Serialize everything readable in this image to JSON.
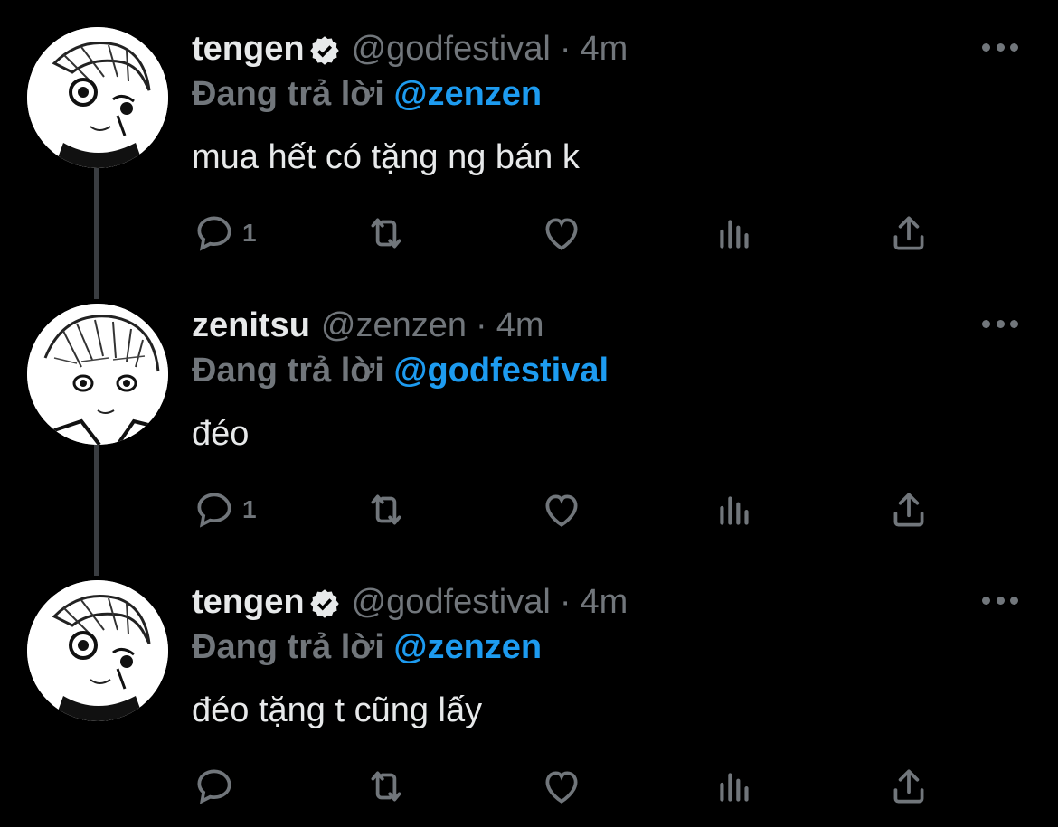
{
  "colors": {
    "background": "#000000",
    "text": "#e7e9ea",
    "muted": "#71767b",
    "accent": "#1d9bf0",
    "thread_line": "#3a3d41"
  },
  "icons": {
    "reply": "comment-bubble-icon",
    "retweet": "retweet-arrows-icon",
    "like": "heart-icon",
    "views": "bar-chart-icon",
    "share": "share-upload-icon",
    "more": "ellipsis-icon",
    "verified": "verified-badge-icon"
  },
  "tweets": [
    {
      "display_name": "tengen",
      "verified": true,
      "handle": "@godfestival",
      "separator": "·",
      "time": "4m",
      "replying_prefix": "Đang trả lời",
      "replying_to": "@zenzen",
      "text": "mua hết có tặng ng bán k",
      "reply_count": "1"
    },
    {
      "display_name": "zenitsu",
      "verified": false,
      "handle": "@zenzen",
      "separator": "·",
      "time": "4m",
      "replying_prefix": "Đang trả lời",
      "replying_to": "@godfestival",
      "text": "đéo",
      "reply_count": "1"
    },
    {
      "display_name": "tengen",
      "verified": true,
      "handle": "@godfestival",
      "separator": "·",
      "time": "4m",
      "replying_prefix": "Đang trả lời",
      "replying_to": "@zenzen",
      "text": "đéo tặng t cũng lấy",
      "reply_count": ""
    }
  ]
}
